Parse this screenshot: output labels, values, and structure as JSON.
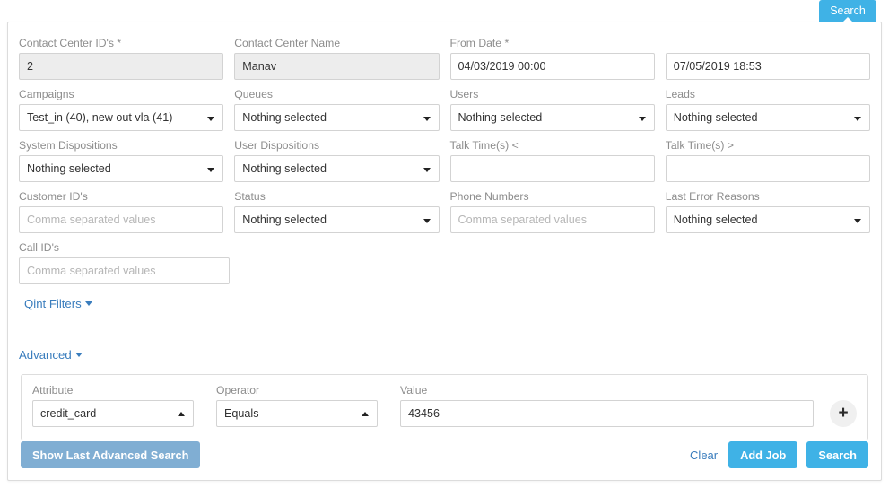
{
  "tab": {
    "search_label": "Search"
  },
  "fields": {
    "contact_center_ids": {
      "label": "Contact Center ID's *",
      "value": "2"
    },
    "contact_center_name": {
      "label": "Contact Center Name",
      "value": "Manav"
    },
    "from_date": {
      "label": "From Date *",
      "value": "04/03/2019 00:00"
    },
    "to_date": {
      "label": "",
      "value": "07/05/2019 18:53"
    },
    "campaigns": {
      "label": "Campaigns",
      "value": "Test_in (40), new out vla (41)"
    },
    "queues": {
      "label": "Queues",
      "value": "Nothing selected"
    },
    "users": {
      "label": "Users",
      "value": "Nothing selected"
    },
    "leads": {
      "label": "Leads",
      "value": "Nothing selected"
    },
    "system_dispositions": {
      "label": "System Dispositions",
      "value": "Nothing selected"
    },
    "user_dispositions": {
      "label": "User Dispositions",
      "value": "Nothing selected"
    },
    "talk_time_less": {
      "label": "Talk Time(s) <",
      "value": ""
    },
    "talk_time_greater": {
      "label": "Talk Time(s) >",
      "value": ""
    },
    "customer_ids": {
      "label": "Customer ID's",
      "value": "",
      "placeholder": "Comma separated values"
    },
    "status": {
      "label": "Status",
      "value": "Nothing selected"
    },
    "phone_numbers": {
      "label": "Phone Numbers",
      "value": "",
      "placeholder": "Comma separated values"
    },
    "last_error_reasons": {
      "label": "Last Error Reasons",
      "value": "Nothing selected"
    },
    "call_ids": {
      "label": "Call ID's",
      "value": "",
      "placeholder": "Comma separated values"
    }
  },
  "links": {
    "qint_filters": "Qint Filters",
    "advanced": "Advanced"
  },
  "advanced": {
    "attribute": {
      "label": "Attribute",
      "value": "credit_card"
    },
    "operator": {
      "label": "Operator",
      "value": "Equals"
    },
    "value": {
      "label": "Value",
      "value": "43456"
    },
    "add_row_label": "+"
  },
  "footer": {
    "show_last_advanced_search": "Show Last Advanced Search",
    "clear": "Clear",
    "add_job": "Add Job",
    "search": "Search"
  },
  "colors": {
    "primary_blue": "#3fb2e6",
    "muted_blue": "#80aed3",
    "link_blue": "#3a7dbd",
    "label_gray": "#8d8d8d",
    "input_border": "#d3d3d3",
    "readonly_bg": "#ededed"
  }
}
